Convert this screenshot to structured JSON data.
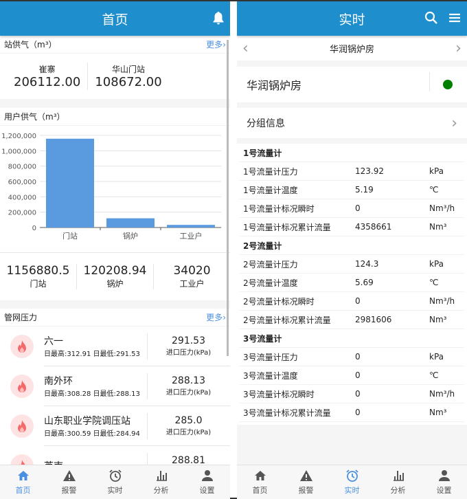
{
  "home": {
    "title": "首页",
    "station_supply": {
      "title": "站供气（m³）",
      "more": "更多",
      "items": [
        {
          "name": "崔寨",
          "value": "206112.00"
        },
        {
          "name": "华山门站",
          "value": "108672.00"
        }
      ]
    },
    "user_supply": {
      "title": "用户供气（m³）",
      "totals": [
        {
          "name": "门站",
          "value": "1156880.5"
        },
        {
          "name": "锅炉",
          "value": "120208.94"
        },
        {
          "name": "工业户",
          "value": "34020"
        }
      ]
    },
    "pipe_pressure": {
      "title": "管网压力",
      "more": "更多",
      "items": [
        {
          "name": "六一",
          "minmax": "日最高:312.91 日最低:291.53",
          "value": "291.53",
          "unit": "进口压力(kPa)"
        },
        {
          "name": "南外环",
          "minmax": "日最高:308.28 日最低:288.13",
          "value": "288.13",
          "unit": "进口压力(kPa)"
        },
        {
          "name": "山东职业学院调压站",
          "minmax": "日最高:300.59 日最低:284.94",
          "value": "285.0",
          "unit": "进口压力(kPa)"
        },
        {
          "name": "芦南",
          "minmax": "",
          "value": "288.81",
          "unit": "进口压力(kPa)"
        }
      ]
    }
  },
  "chart_data": {
    "type": "bar",
    "categories": [
      "门站",
      "锅炉",
      "工业户"
    ],
    "values": [
      1156880.5,
      120208.94,
      34020
    ],
    "ylim": [
      0,
      1200000
    ],
    "yticks": [
      "0",
      "200,000",
      "400,000",
      "600,000",
      "800,000",
      "1,000,000",
      "1,200,000"
    ],
    "grid": true,
    "color": "#5a9be0"
  },
  "realtime": {
    "title": "实时",
    "station": "华润锅炉房",
    "station_name": "华润锅炉房",
    "status_color": "#008000",
    "group_info": "分组信息",
    "groups": [
      {
        "title": "1号流量计",
        "rows": [
          [
            "1号流量计压力",
            "123.92",
            "kPa"
          ],
          [
            "1号流量计温度",
            "5.19",
            "℃"
          ],
          [
            "1号流量计标况瞬时",
            "0",
            "Nm³/h"
          ],
          [
            "1号流量计标况累计流量",
            "4358661",
            "Nm³"
          ]
        ]
      },
      {
        "title": "2号流量计",
        "rows": [
          [
            "2号流量计压力",
            "124.3",
            "kPa"
          ],
          [
            "2号流量计温度",
            "5.69",
            "℃"
          ],
          [
            "2号流量计标况瞬时",
            "0",
            "Nm³/h"
          ],
          [
            "2号流量计标况累计流量",
            "2981606",
            "Nm³"
          ]
        ]
      },
      {
        "title": "3号流量计",
        "rows": [
          [
            "3号流量计压力",
            "0",
            "kPa"
          ],
          [
            "3号流量计温度",
            "0",
            "℃"
          ],
          [
            "3号流量计标况瞬时",
            "0",
            "Nm³/h"
          ],
          [
            "3号流量计标况累计流量",
            "0",
            "Nm³"
          ]
        ]
      }
    ]
  },
  "tabs": [
    {
      "label": "首页",
      "icon": "home-icon"
    },
    {
      "label": "报警",
      "icon": "warning-icon"
    },
    {
      "label": "实时",
      "icon": "alarm-clock-icon"
    },
    {
      "label": "分析",
      "icon": "bar-chart-icon"
    },
    {
      "label": "设置",
      "icon": "user-icon"
    }
  ],
  "accent": "#1e8fcc"
}
